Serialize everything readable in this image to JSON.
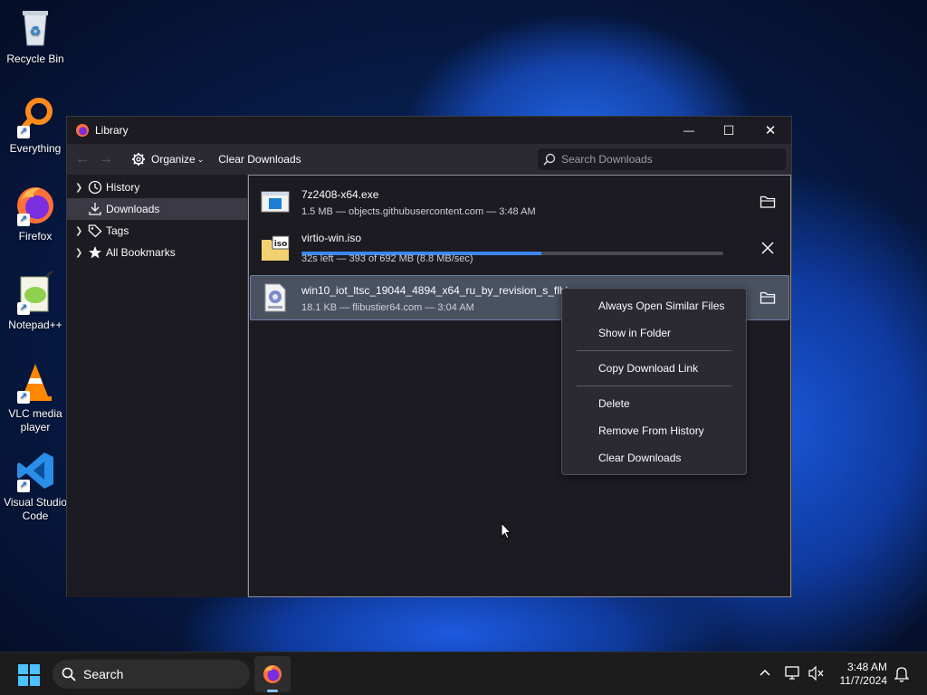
{
  "desktop": {
    "icons": [
      {
        "label": "Recycle Bin"
      },
      {
        "label": "Everything"
      },
      {
        "label": "Firefox"
      },
      {
        "label": "Notepad++"
      },
      {
        "label": "VLC media player"
      },
      {
        "label": "Visual Studio Code"
      }
    ]
  },
  "window": {
    "title": "Library",
    "controls": {
      "minimize": "—",
      "maximize": "☐",
      "close": "✕"
    }
  },
  "toolbar": {
    "back": "←",
    "forward": "→",
    "organize_label": "Organize",
    "organize_caret": "⌄",
    "clear_downloads_label": "Clear Downloads",
    "search_placeholder": "Search Downloads"
  },
  "sidebar": {
    "items": [
      {
        "label": "History",
        "icon": "clock-icon"
      },
      {
        "label": "Downloads",
        "icon": "download-icon",
        "selected": true
      },
      {
        "label": "Tags",
        "icon": "tag-icon"
      },
      {
        "label": "All Bookmarks",
        "icon": "star-icon"
      }
    ]
  },
  "downloads": [
    {
      "name": "7z2408-x64.exe",
      "status": "1.5 MB — objects.githubusercontent.com — 3:48 AM",
      "icon": "exe-file-icon",
      "action": "folder-icon"
    },
    {
      "name": "virtio-win.iso",
      "status": "32s left — 393 of 692 MB (8.8 MB/sec)",
      "progress": 0.568,
      "icon": "iso-file-icon",
      "action": "cancel-icon"
    },
    {
      "name": "win10_iot_ltsc_19044_4894_x64_ru_by_revision_s_flblauncher.iso.torrent",
      "status": "18.1 KB — flibustier64.com — 3:04 AM",
      "icon": "torrent-file-icon",
      "action": "folder-icon",
      "selected": true
    }
  ],
  "context_menu": {
    "always_open": "Always Open Similar Files",
    "show_in_folder": "Show in Folder",
    "copy_link": "Copy Download Link",
    "delete": "Delete",
    "remove_history": "Remove From History",
    "clear_downloads": "Clear Downloads"
  },
  "taskbar": {
    "search_label": "Search",
    "time": "3:48 AM",
    "date": "11/7/2024"
  },
  "colors": {
    "accent": "#3b86f0",
    "window_bg": "#1c1b22",
    "toolbar_bg": "#2b2a33"
  }
}
